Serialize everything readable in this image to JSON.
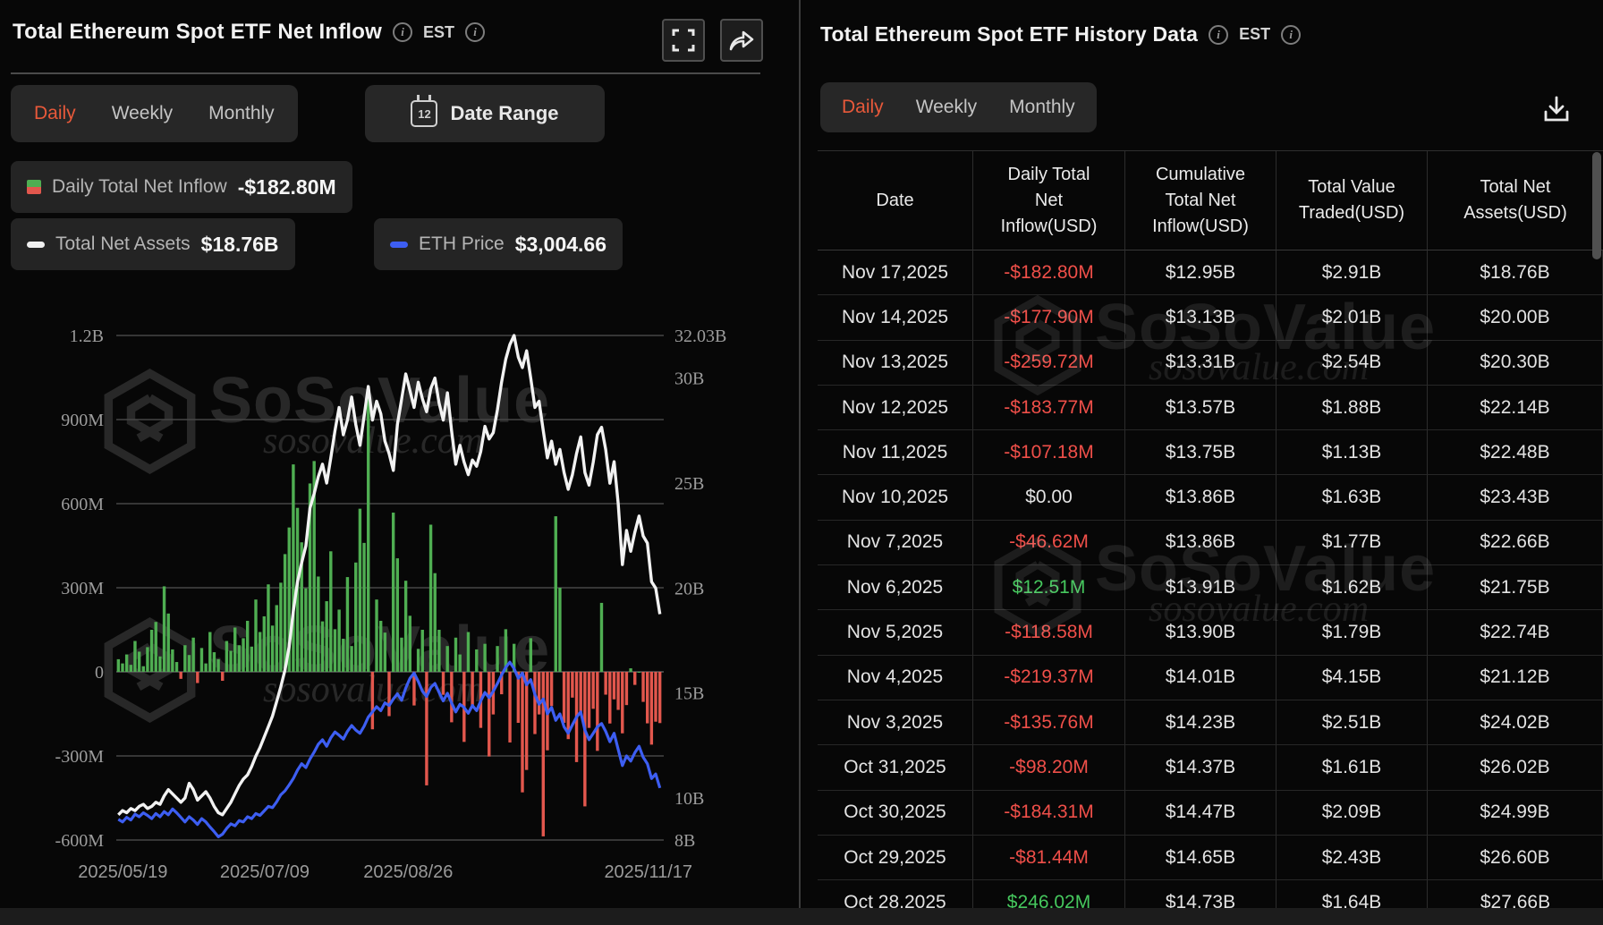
{
  "left_panel": {
    "title": "Total Ethereum Spot ETF Net Inflow",
    "est_label": "EST",
    "tabs": {
      "daily": "Daily",
      "weekly": "Weekly",
      "monthly": "Monthly"
    },
    "date_range_label": "Date Range",
    "calendar_icon_text": "12",
    "legend": {
      "inflow_label": "Daily Total Net Inflow",
      "inflow_value": "-$182.80M",
      "tna_label": "Total Net Assets",
      "tna_value": "$18.76B",
      "eth_label": "ETH Price",
      "eth_value": "$3,004.66"
    }
  },
  "right_panel": {
    "title": "Total Ethereum Spot ETF History Data",
    "est_label": "EST",
    "tabs": {
      "daily": "Daily",
      "weekly": "Weekly",
      "monthly": "Monthly"
    },
    "table": {
      "columns": [
        "Date",
        "Daily Total\nNet\nInflow(USD)",
        "Cumulative\nTotal Net\nInflow(USD)",
        "Total Value\nTraded(USD)",
        "Total Net\nAssets(USD)"
      ],
      "rows": [
        [
          "Nov 17,2025",
          "-$182.80M",
          "$12.95B",
          "$2.91B",
          "$18.76B"
        ],
        [
          "Nov 14,2025",
          "-$177.90M",
          "$13.13B",
          "$2.01B",
          "$20.00B"
        ],
        [
          "Nov 13,2025",
          "-$259.72M",
          "$13.31B",
          "$2.54B",
          "$20.30B"
        ],
        [
          "Nov 12,2025",
          "-$183.77M",
          "$13.57B",
          "$1.88B",
          "$22.14B"
        ],
        [
          "Nov 11,2025",
          "-$107.18M",
          "$13.75B",
          "$1.13B",
          "$22.48B"
        ],
        [
          "Nov 10,2025",
          "$0.00",
          "$13.86B",
          "$1.63B",
          "$23.43B"
        ],
        [
          "Nov 7,2025",
          "-$46.62M",
          "$13.86B",
          "$1.77B",
          "$22.66B"
        ],
        [
          "Nov 6,2025",
          "$12.51M",
          "$13.91B",
          "$1.62B",
          "$21.75B"
        ],
        [
          "Nov 5,2025",
          "-$118.58M",
          "$13.90B",
          "$1.79B",
          "$22.74B"
        ],
        [
          "Nov 4,2025",
          "-$219.37M",
          "$14.01B",
          "$4.15B",
          "$21.12B"
        ],
        [
          "Nov 3,2025",
          "-$135.76M",
          "$14.23B",
          "$2.51B",
          "$24.02B"
        ],
        [
          "Oct 31,2025",
          "-$98.20M",
          "$14.37B",
          "$1.61B",
          "$26.02B"
        ],
        [
          "Oct 30,2025",
          "-$184.31M",
          "$14.47B",
          "$2.09B",
          "$24.99B"
        ],
        [
          "Oct 29,2025",
          "-$81.44M",
          "$14.65B",
          "$2.43B",
          "$26.60B"
        ],
        [
          "Oct 28,2025",
          "$246.02M",
          "$14.73B",
          "$1.64B",
          "$27.66B"
        ]
      ]
    }
  },
  "watermark": {
    "brand": "SoSoValue",
    "domain": "sosovalue.com"
  },
  "colors": {
    "accent_orange": "#e8593a",
    "bar_green": "#4fae52",
    "bar_red": "#e2574d",
    "line_white": "#f2f2f2",
    "line_blue": "#3d5ef2",
    "text_red": "#ef4f49",
    "text_green": "#46c85e"
  },
  "chart_data": {
    "type": "composite (bar + 2 lines, dual axis)",
    "title": "Total Ethereum Spot ETF Net Inflow",
    "x_range": [
      "2025/05/19",
      "2025/11/17"
    ],
    "x_tick_labels": [
      {
        "label": "2025/05/19",
        "frac": 0.012
      },
      {
        "label": "2025/07/09",
        "frac": 0.272
      },
      {
        "label": "2025/08/26",
        "frac": 0.535
      },
      {
        "label": "2025/11/17",
        "frac": 0.975
      }
    ],
    "left_axis": {
      "title": "Daily Net Inflow (USD)",
      "min": -600,
      "max": 1200,
      "unit": "M",
      "labels": [
        {
          "text": "1.2B",
          "v": 1200
        },
        {
          "text": "900M",
          "v": 900
        },
        {
          "text": "600M",
          "v": 600
        },
        {
          "text": "300M",
          "v": 300
        },
        {
          "text": "0",
          "v": 0
        },
        {
          "text": "-300M",
          "v": -300
        },
        {
          "text": "-600M",
          "v": -600
        }
      ]
    },
    "right_axis": {
      "title": "Total Net Assets (USD)",
      "min": 8,
      "max": 32.03,
      "unit": "B",
      "labels": [
        {
          "text": "32.03B",
          "v": 32.03
        },
        {
          "text": "30B",
          "v": 30
        },
        {
          "text": "25B",
          "v": 25
        },
        {
          "text": "20B",
          "v": 20
        },
        {
          "text": "15B",
          "v": 15
        },
        {
          "text": "10B",
          "v": 10
        },
        {
          "text": "8B",
          "v": 8
        }
      ]
    },
    "eth_axis": {
      "title": "ETH Price (hidden axis)",
      "min": 2200,
      "max": 10000
    },
    "series": [
      {
        "name": "Daily Total Net Inflow",
        "type": "bar",
        "axis": "left",
        "unit": "USD millions",
        "values": [
          45,
          30,
          62,
          25,
          110,
          72,
          20,
          88,
          150,
          178,
          55,
          305,
          208,
          80,
          35,
          -25,
          95,
          60,
          122,
          -40,
          85,
          30,
          142,
          70,
          45,
          -32,
          110,
          75,
          158,
          95,
          120,
          182,
          90,
          258,
          142,
          198,
          312,
          165,
          238,
          318,
          420,
          515,
          740,
          585,
          462,
          298,
          672,
          752,
          340,
          180,
          252,
          430,
          152,
          222,
          118,
          338,
          92,
          390,
          582,
          460,
          1010,
          -205,
          258,
          182,
          140,
          -158,
          568,
          405,
          122,
          325,
          200,
          -120,
          82,
          150,
          -405,
          525,
          352,
          150,
          -82,
          92,
          -180,
          122,
          62,
          -250,
          142,
          -122,
          80,
          -200,
          100,
          -302,
          -152,
          92,
          -80,
          152,
          -252,
          100,
          -182,
          -430,
          -350,
          120,
          -222,
          -152,
          -587,
          -280,
          -122,
          555,
          300,
          -182,
          -240,
          -92,
          -322,
          -152,
          -480,
          -200,
          -132,
          -282,
          246.02,
          -81.44,
          -184.31,
          -98.2,
          -135.76,
          -219.37,
          -118.58,
          12.51,
          -46.62,
          0,
          -107.18,
          -183.77,
          -259.72,
          -177.9,
          -182.8
        ]
      },
      {
        "name": "Total Net Assets",
        "type": "line",
        "axis": "right",
        "unit": "USD billions",
        "values": [
          9.2,
          9.4,
          9.3,
          9.5,
          9.4,
          9.6,
          9.7,
          9.5,
          9.6,
          9.8,
          9.7,
          10.1,
          10.4,
          10.2,
          10.0,
          9.8,
          10.0,
          10.7,
          10.4,
          9.9,
          10.1,
          10.3,
          10.0,
          9.6,
          9.3,
          9.2,
          9.5,
          9.8,
          10.2,
          10.6,
          10.9,
          11.1,
          11.5,
          12.0,
          12.4,
          12.9,
          13.4,
          13.9,
          14.6,
          15.3,
          16.1,
          17.2,
          18.9,
          20.3,
          21.2,
          22.0,
          23.8,
          24.5,
          25.3,
          25.9,
          25.0,
          26.2,
          27.5,
          28.6,
          27.3,
          28.0,
          29.1,
          27.8,
          26.8,
          28.2,
          29.6,
          28.0,
          28.9,
          28.3,
          27.0,
          26.4,
          25.6,
          27.8,
          29.0,
          30.2,
          29.4,
          28.6,
          29.8,
          29.0,
          28.4,
          29.5,
          30.0,
          28.8,
          28.0,
          29.3,
          27.5,
          25.9,
          26.8,
          26.0,
          25.4,
          26.1,
          25.8,
          26.5,
          27.7,
          27.1,
          27.4,
          28.5,
          29.8,
          30.9,
          31.6,
          32.03,
          31.0,
          30.5,
          31.3,
          30.0,
          28.6,
          28.9,
          27.5,
          26.2,
          27.0,
          25.9,
          26.6,
          25.5,
          24.7,
          25.4,
          26.4,
          27.2,
          25.5,
          24.9,
          26.0,
          27.3,
          27.66,
          26.6,
          24.99,
          26.02,
          24.02,
          21.12,
          22.74,
          21.75,
          22.66,
          23.43,
          22.48,
          22.14,
          20.3,
          20.0,
          18.76
        ]
      },
      {
        "name": "ETH Price",
        "type": "line",
        "axis": "eth",
        "unit": "USD",
        "values": [
          2520,
          2480,
          2550,
          2510,
          2600,
          2560,
          2620,
          2580,
          2530,
          2610,
          2560,
          2640,
          2590,
          2680,
          2620,
          2550,
          2480,
          2560,
          2510,
          2440,
          2530,
          2480,
          2400,
          2330,
          2250,
          2290,
          2380,
          2450,
          2420,
          2500,
          2480,
          2560,
          2530,
          2610,
          2580,
          2650,
          2720,
          2700,
          2790,
          2900,
          2960,
          3050,
          3150,
          3280,
          3380,
          3320,
          3450,
          3560,
          3680,
          3750,
          3650,
          3780,
          3870,
          3820,
          3760,
          3880,
          3970,
          3900,
          3850,
          3960,
          4100,
          4180,
          4260,
          4200,
          4320,
          4280,
          4380,
          4460,
          4360,
          4550,
          4700,
          4780,
          4650,
          4500,
          4420,
          4560,
          4620,
          4480,
          4350,
          4470,
          4320,
          4180,
          4300,
          4250,
          4160,
          4280,
          4200,
          4350,
          4480,
          4400,
          4500,
          4620,
          4750,
          4870,
          4950,
          4850,
          4700,
          4780,
          4600,
          4680,
          4450,
          4300,
          4380,
          4150,
          4250,
          4050,
          4150,
          3950,
          3850,
          3980,
          4100,
          4180,
          3900,
          3750,
          3850,
          3950,
          4000,
          3880,
          3720,
          3850,
          3600,
          3350,
          3500,
          3420,
          3550,
          3650,
          3480,
          3380,
          3150,
          3220,
          3004.66
        ]
      }
    ],
    "legend_position": "top-left chips",
    "grid": true
  }
}
